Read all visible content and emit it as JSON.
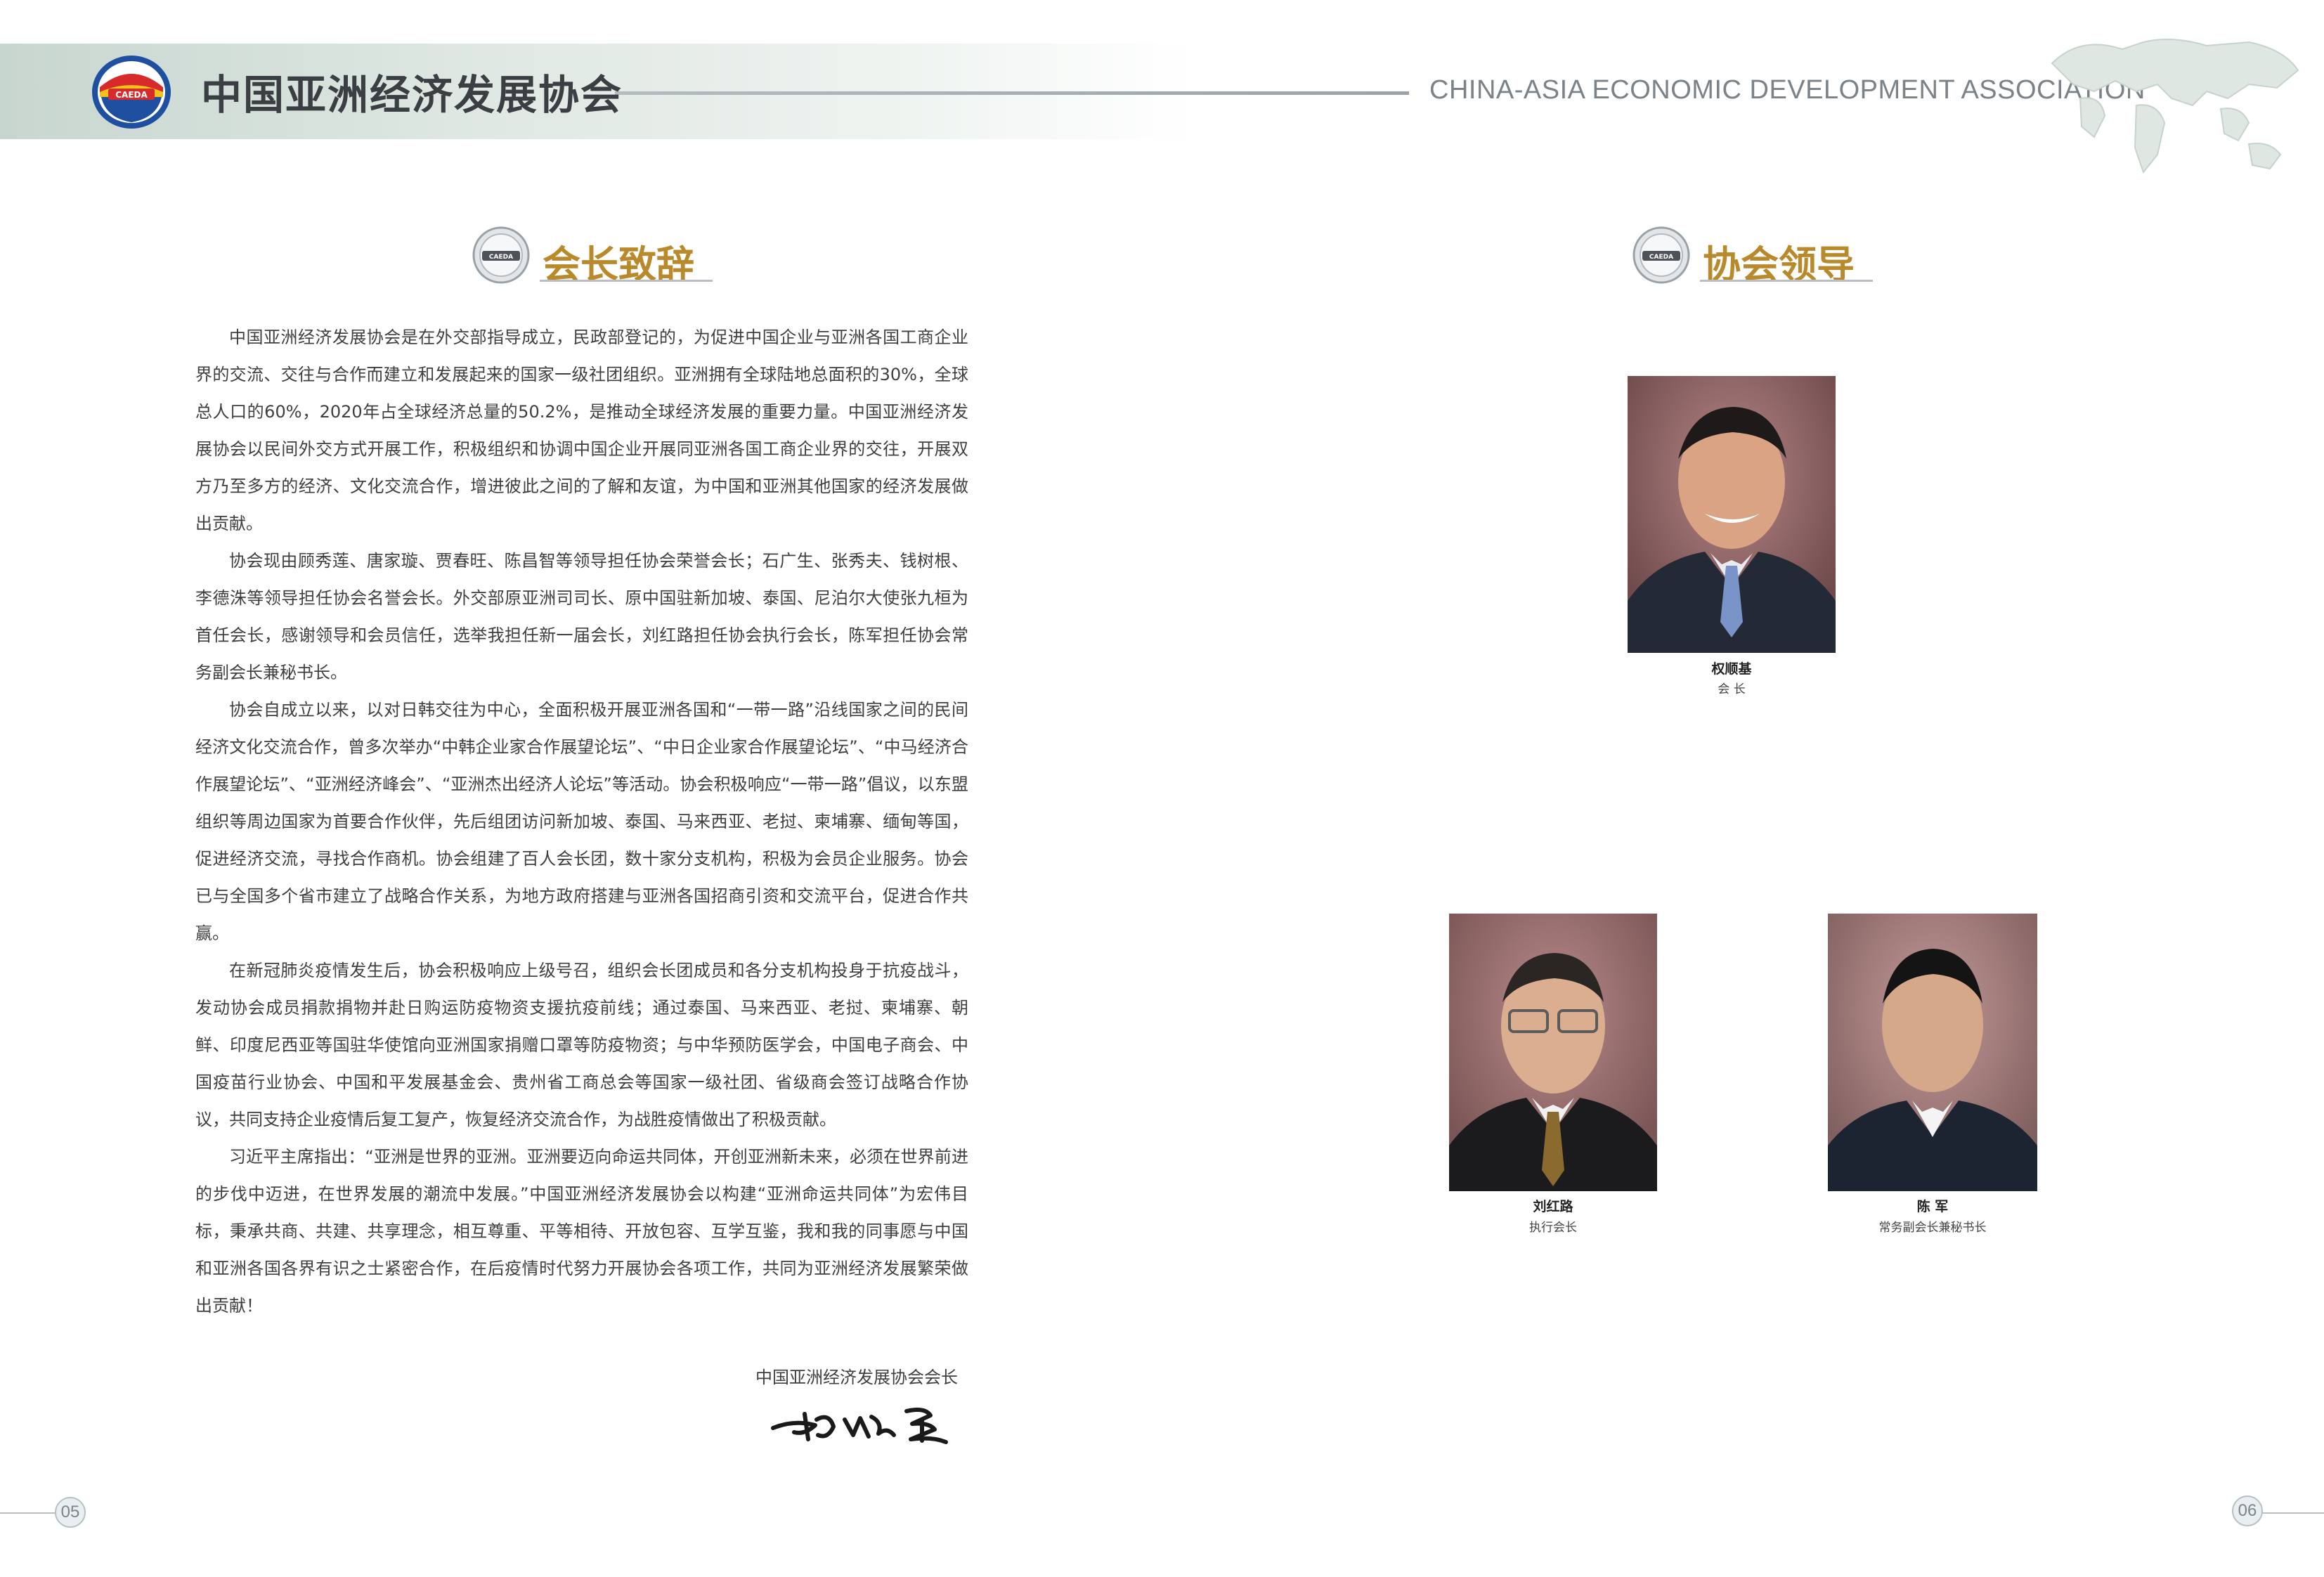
{
  "header": {
    "org_name_cn": "中国亚洲经济发展协会",
    "org_name_en": "CHINA-ASIA ECONOMIC DEVELOPMENT ASSOCIATION",
    "logo_text": "CAEDA"
  },
  "left_section": {
    "title": "会长致辞",
    "paragraphs": [
      "中国亚洲经济发展协会是在外交部指导成立，民政部登记的，为促进中国企业与亚洲各国工商企业界的交流、交往与合作而建立和发展起来的国家一级社团组织。亚洲拥有全球陆地总面积的30%，全球总人口的60%，2020年占全球经济总量的50.2%，是推动全球经济发展的重要力量。中国亚洲经济发展协会以民间外交方式开展工作，积极组织和协调中国企业开展同亚洲各国工商企业界的交往，开展双方乃至多方的经济、文化交流合作，增进彼此之间的了解和友谊，为中国和亚洲其他国家的经济发展做出贡献。",
      "协会现由顾秀莲、唐家璇、贾春旺、陈昌智等领导担任协会荣誉会长；石广生、张秀夫、钱树根、李德洙等领导担任协会名誉会长。外交部原亚洲司司长、原中国驻新加坡、泰国、尼泊尔大使张九桓为首任会长，感谢领导和会员信任，选举我担任新一届会长，刘红路担任协会执行会长，陈军担任协会常务副会长兼秘书长。",
      "协会自成立以来，以对日韩交往为中心，全面积极开展亚洲各国和“一带一路”沿线国家之间的民间经济文化交流合作，曾多次举办“中韩企业家合作展望论坛”、“中日企业家合作展望论坛”、“中马经济合作展望论坛”、“亚洲经济峰会”、“亚洲杰出经济人论坛”等活动。协会积极响应“一带一路”倡议，以东盟组织等周边国家为首要合作伙伴，先后组团访问新加坡、泰国、马来西亚、老挝、柬埔寨、缅甸等国，促进经济交流，寻找合作商机。协会组建了百人会长团，数十家分支机构，积极为会员企业服务。协会已与全国多个省市建立了战略合作关系，为地方政府搭建与亚洲各国招商引资和交流平台，促进合作共赢。",
      "在新冠肺炎疫情发生后，协会积极响应上级号召，组织会长团成员和各分支机构投身于抗疫战斗，发动协会成员捐款捐物并赴日购运防疫物资支援抗疫前线；通过泰国、马来西亚、老挝、柬埔寨、朝鲜、印度尼西亚等国驻华使馆向亚洲国家捐赠口罩等防疫物资；与中华预防医学会，中国电子商会、中国疫苗行业协会、中国和平发展基金会、贵州省工商总会等国家一级社团、省级商会签订战略合作协议，共同支持企业疫情后复工复产，恢复经济交流合作，为战胜疫情做出了积极贡献。",
      "习近平主席指出：“亚洲是世界的亚洲。亚洲要迈向命运共同体，开创亚洲新未来，必须在世界前进的步伐中迈进，在世界发展的潮流中发展。”中国亚洲经济发展协会以构建“亚洲命运共同体”为宏伟目标，秉承共商、共建、共享理念，相互尊重、平等相待、开放包容、互学互鉴，我和我的同事愿与中国和亚洲各国各界有识之士紧密合作，在后疫情时代努力开展协会各项工作，共同为亚洲经济发展繁荣做出贡献！"
    ],
    "signoff": "中国亚洲经济发展协会会长"
  },
  "right_section": {
    "title": "协会领导",
    "leaders": [
      {
        "name": "权顺基",
        "role": "会  长"
      },
      {
        "name": "刘红路",
        "role": "执行会长"
      },
      {
        "name": "陈  军",
        "role": "常务副会长兼秘书长"
      }
    ]
  },
  "pages": {
    "left": "05",
    "right": "06"
  },
  "colors": {
    "heading_gold": "#b98a2b",
    "text": "#3f3f3f",
    "portrait_bg": "#9a6f6e"
  }
}
